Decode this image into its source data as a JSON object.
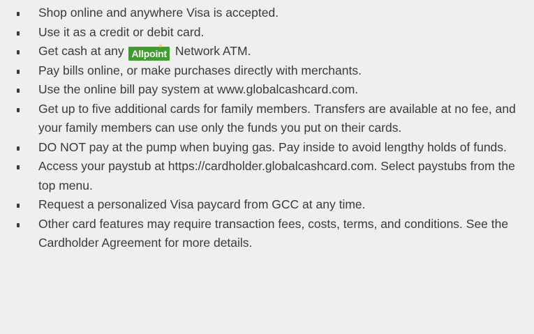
{
  "list": {
    "items": [
      {
        "text": "Shop online and anywhere Visa is  accepted."
      },
      {
        "text": "Use it as a credit or debit card."
      },
      {
        "before": "Get cash at any",
        "logo": "Allpoint",
        "after": "Network ATM."
      },
      {
        "text": "Pay bills online, or make purchases directly with merchants."
      },
      {
        "text": "Use the online bill pay system at www.globalcashcard.com."
      },
      {
        "text": "Get up to five additional cards for family members. Transfers are available at no fee, and your family members can use only the funds you put on their cards."
      },
      {
        "text": "DO NOT pay at the pump when buying gas. Pay inside to avoid lengthy holds of funds."
      },
      {
        "text": "Access your paystub at https://cardholder.globalcashcard.com. Select paystubs from the top menu."
      },
      {
        "text": "Request a personalized Visa paycard from GCC at any time."
      },
      {
        "text": "Other card features may require transaction fees, costs, terms, and conditions. See the Cardholder Agreement for more details."
      }
    ]
  },
  "colors": {
    "background": "#efefef",
    "text": "#3a3a3a",
    "allpoint_green": "#3f9d2f",
    "allpoint_star": "#f4d03f"
  },
  "icons": {
    "bullet": "bullet-icon",
    "allpoint": "allpoint-logo-icon"
  }
}
